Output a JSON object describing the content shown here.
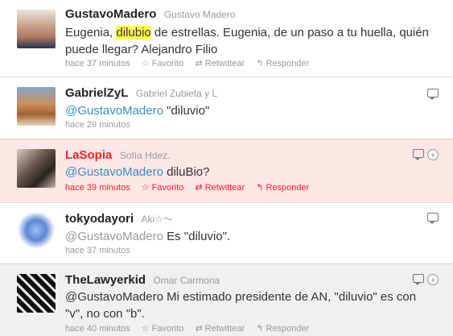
{
  "tweets": [
    {
      "screen_name": "GustavoMadero",
      "full_name": "Gustavo Madero",
      "body_pre": "Eugenia, ",
      "body_highlight": "dilubio",
      "body_post": " de estrellas. Eugenia, de un paso a tu huella, quién puede llegar? Alejandro Filio",
      "time": "hace 37 minutos",
      "favorite": "Favorito",
      "retweet": "Retwittear",
      "reply": "Responder"
    },
    {
      "screen_name": "GabrielZyL",
      "full_name": "Gabriel Zubieta y L",
      "mention": "@GustavoMadero",
      "body": " \"diluvio\"",
      "time": "hace 29 minutos"
    },
    {
      "screen_name": "LaSopia",
      "full_name": "Sofía Hdez.",
      "mention": "@GustavoMadero",
      "body": " diluBio?",
      "time": "hace 39 minutos",
      "favorite": "Favorito",
      "retweet": "Retwittear",
      "reply": "Responder"
    },
    {
      "screen_name": "tokyodayori",
      "full_name": "Aki☆〜",
      "mention": "@GustavoMadero",
      "body": " Es \"diluvio\".",
      "time": "hace 37 minutos"
    },
    {
      "screen_name": "TheLawyerkid",
      "full_name": "Omar Carmona",
      "mention": "@GustavoMadero",
      "body": " Mi estimado presidente de AN, \"diluvio\" es con \"v\", no con \"b\".",
      "time": "hace 40 minutos",
      "favorite": "Favorito",
      "retweet": "Retwittear",
      "reply": "Responder"
    }
  ],
  "colors": {
    "highlight_row": "#fde6e6",
    "gray_row": "#f0f0ee",
    "link": "#3b8cc4",
    "alert": "#e22222"
  }
}
